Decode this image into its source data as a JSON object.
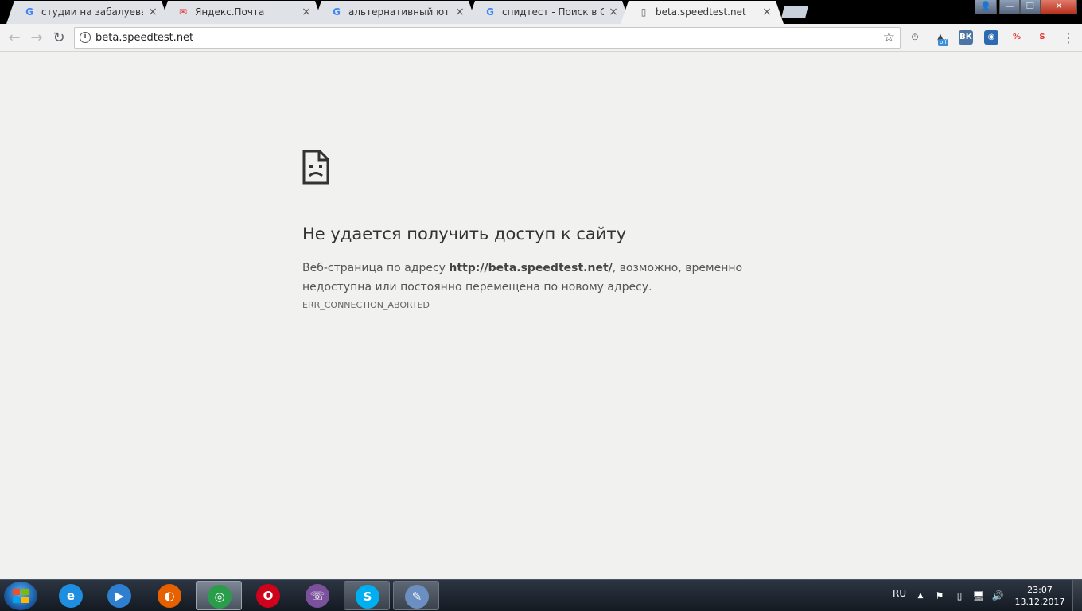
{
  "tabs": [
    {
      "title": "студии на забалуева - П",
      "favicon": "google-icon",
      "active": false
    },
    {
      "title": "Яндекс.Почта",
      "favicon": "yandex-mail-icon",
      "active": false
    },
    {
      "title": "альтернативный ютуб -",
      "favicon": "google-icon",
      "active": false
    },
    {
      "title": "спидтест - Поиск в Goo",
      "favicon": "google-icon",
      "active": false
    },
    {
      "title": "beta.speedtest.net",
      "favicon": "page-icon",
      "active": true
    }
  ],
  "toolbar": {
    "back": "←",
    "forward": "→",
    "reload": "↻",
    "url": "beta.speedtest.net",
    "extensions": [
      {
        "name": "speedometer-extension-icon",
        "glyph": "◷",
        "color": "#f2f2f2",
        "badge": ""
      },
      {
        "name": "vpn-extension-icon",
        "glyph": "▲",
        "color": "#f2f2f2",
        "badge": "off"
      },
      {
        "name": "vk-extension-icon",
        "glyph": "ВК",
        "color": "#4c75a3",
        "badge": ""
      },
      {
        "name": "circle-extension-icon",
        "glyph": "◉",
        "color": "#2b6cb0",
        "badge": ""
      },
      {
        "name": "percent-extension-icon",
        "glyph": "%",
        "color": "#f2f2f2",
        "badge": ""
      },
      {
        "name": "s-extension-icon",
        "glyph": "S",
        "color": "#f2f2f2",
        "badge": ""
      }
    ]
  },
  "error": {
    "heading": "Не удается получить доступ к сайту",
    "desc_prefix": "Веб-страница по адресу ",
    "desc_url": "http://beta.speedtest.net/",
    "desc_suffix": ", возможно, временно недоступна или постоянно перемещена по новому адресу.",
    "code": "ERR_CONNECTION_ABORTED"
  },
  "taskbar": {
    "apps": [
      {
        "name": "internet-explorer-icon",
        "glyph": "e",
        "color": "#1e8fe0"
      },
      {
        "name": "media-player-icon",
        "glyph": "▶",
        "color": "#2e7fd0"
      },
      {
        "name": "firefox-icon",
        "glyph": "◐",
        "color": "#e66000"
      },
      {
        "name": "chrome-icon",
        "glyph": "◎",
        "color": "#2a9d4b"
      },
      {
        "name": "opera-icon",
        "glyph": "O",
        "color": "#d0021b"
      },
      {
        "name": "viber-icon",
        "glyph": "☏",
        "color": "#7b519d"
      },
      {
        "name": "skype-icon",
        "glyph": "S",
        "color": "#00aff0"
      },
      {
        "name": "paint-icon",
        "glyph": "✎",
        "color": "#6a8fc0"
      }
    ],
    "language": "RU",
    "time": "23:07",
    "date": "13.12.2017"
  }
}
